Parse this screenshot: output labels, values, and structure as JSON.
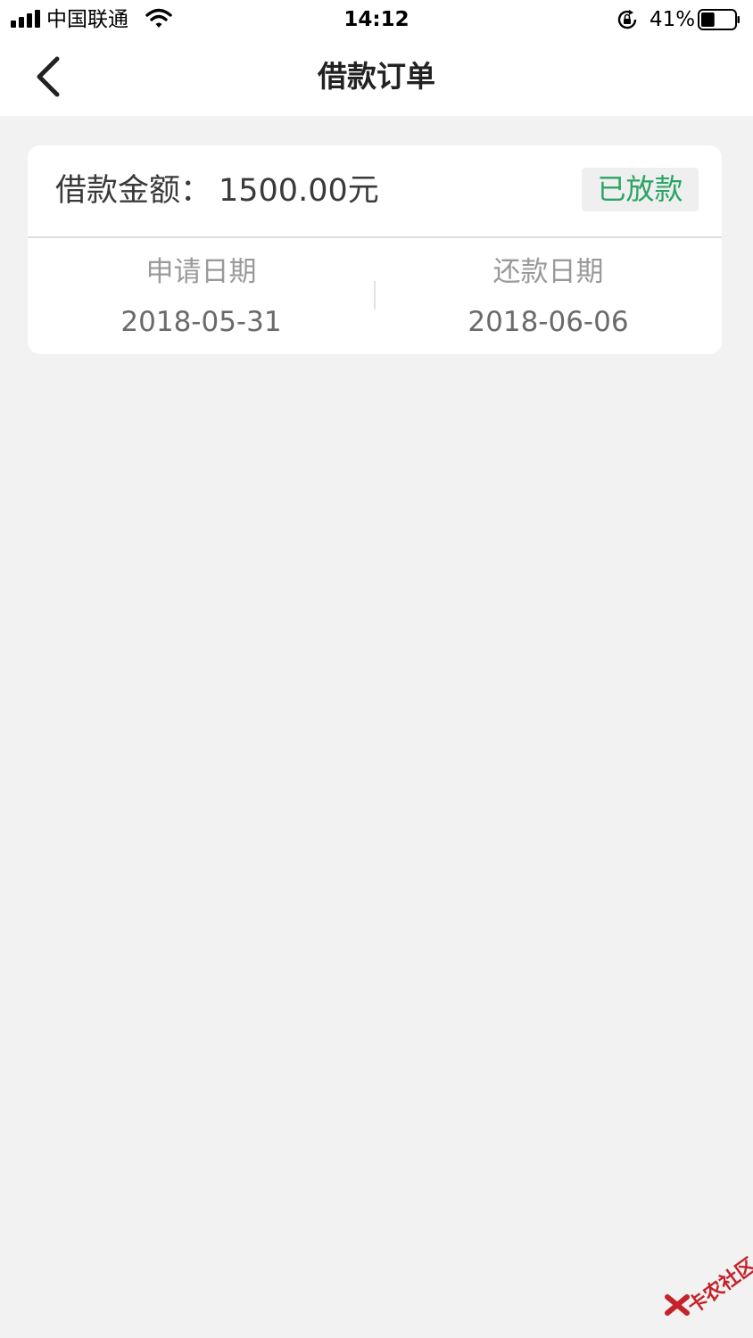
{
  "status_bar": {
    "carrier": "中国联通",
    "time": "14:12",
    "battery_percent": "41%",
    "battery_level": 0.41,
    "icons": [
      "signal-icon",
      "wifi-icon",
      "rotation-lock-icon",
      "battery-icon"
    ]
  },
  "nav": {
    "title": "借款订单",
    "back_icon": "chevron-left-icon"
  },
  "order": {
    "amount_label": "借款金额：",
    "amount_value": "1500.00元",
    "status": "已放款",
    "apply_date_label": "申请日期",
    "apply_date": "2018-05-31",
    "repay_date_label": "还款日期",
    "repay_date": "2018-06-06"
  },
  "watermark": {
    "text": "卡农社区"
  },
  "colors": {
    "background": "#f2f2f2",
    "status_green": "#2aa565",
    "watermark_red": "#c4232a"
  }
}
